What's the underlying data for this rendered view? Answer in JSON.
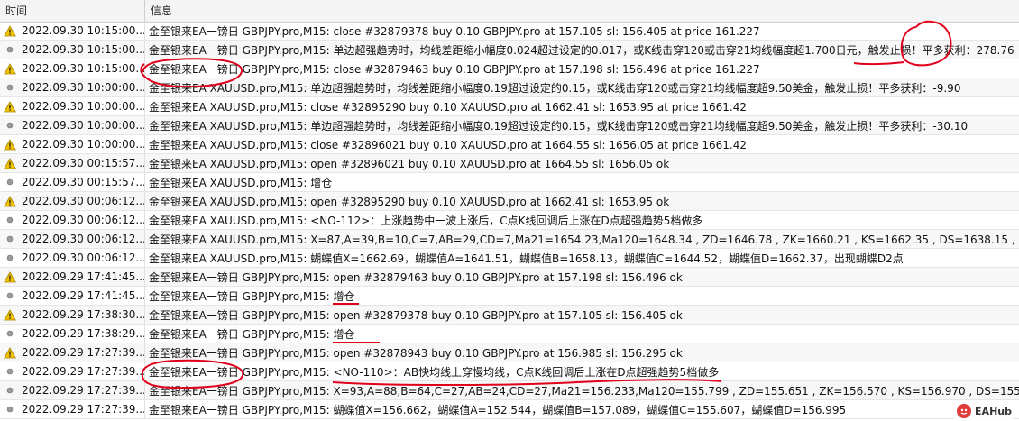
{
  "header": {
    "time": "时间",
    "message": "信息"
  },
  "rows": [
    {
      "icon": "warning",
      "time": "2022.09.30 10:15:00...",
      "msg": "金至银来EA一镑日 GBPJPY.pro,M15: close #32879378 buy 0.10 GBPJPY.pro at 157.105 sl: 156.405 at price 161.227"
    },
    {
      "icon": "info",
      "time": "2022.09.30 10:15:00...",
      "msg": "金至银来EA一镑日 GBPJPY.pro,M15: 单边超强趋势时，均线差距缩小幅度0.024超过设定的0.017，或K线击穿120或击穿21均线幅度超1.700日元，触发止损！平多获利：278.76"
    },
    {
      "icon": "warning",
      "time": "2022.09.30 10:15:00...",
      "msg": "金至银来EA一镑日 GBPJPY.pro,M15: close #32879463 buy 0.10 GBPJPY.pro at 157.198 sl: 156.496 at price 161.227"
    },
    {
      "icon": "info",
      "time": "2022.09.30 10:00:00...",
      "msg": "金至银来EA XAUUSD.pro,M15: 单边超强趋势时，均线差距缩小幅度0.19超过设定的0.15，或K线击穿120或击穿21均线幅度超9.50美金，触发止损！平多获利：-9.90"
    },
    {
      "icon": "warning",
      "time": "2022.09.30 10:00:00...",
      "msg": "金至银来EA XAUUSD.pro,M15: close #32895290 buy 0.10 XAUUSD.pro at 1662.41 sl: 1653.95 at price 1661.42"
    },
    {
      "icon": "info",
      "time": "2022.09.30 10:00:00...",
      "msg": "金至银来EA XAUUSD.pro,M15: 单边超强趋势时，均线差距缩小幅度0.19超过设定的0.15，或K线击穿120或击穿21均线幅度超9.50美金，触发止损！平多获利：-30.10"
    },
    {
      "icon": "warning",
      "time": "2022.09.30 10:00:00...",
      "msg": "金至银来EA XAUUSD.pro,M15: close #32896021 buy 0.10 XAUUSD.pro at 1664.55 sl: 1656.05 at price 1661.42"
    },
    {
      "icon": "warning",
      "time": "2022.09.30 00:15:57...",
      "msg": "金至银来EA XAUUSD.pro,M15: open #32896021 buy 0.10 XAUUSD.pro at 1664.55 sl: 1656.05 ok"
    },
    {
      "icon": "info",
      "time": "2022.09.30 00:15:57...",
      "msg": "金至银来EA XAUUSD.pro,M15: 增仓"
    },
    {
      "icon": "warning",
      "time": "2022.09.30 00:06:12...",
      "msg": "金至银来EA XAUUSD.pro,M15: open #32895290 buy 0.10 XAUUSD.pro at 1662.41 sl: 1653.95 ok"
    },
    {
      "icon": "info",
      "time": "2022.09.30 00:06:12...",
      "msg": "金至银来EA XAUUSD.pro,M15: <NO-112>：上涨趋势中一波上涨后，C点K线回调后上涨在D点超强趋势5档做多"
    },
    {
      "icon": "info",
      "time": "2022.09.30 00:06:12...",
      "msg": "金至银来EA XAUUSD.pro,M15: X=87,A=39,B=10,C=7,AB=29,CD=7,Ma21=1654.23,Ma120=1648.34 , ZD=1646.78 , ZK=1660.21 , KS=1662.35 , DS=1638.15 , GBH=1650"
    },
    {
      "icon": "info",
      "time": "2022.09.30 00:06:12...",
      "msg": "金至银来EA XAUUSD.pro,M15: 蝴蝶值X=1662.69，蝴蝶值A=1641.51，蝴蝶值B=1658.13，蝴蝶值C=1644.52，蝴蝶值D=1662.37，出现蝴蝶D2点"
    },
    {
      "icon": "warning",
      "time": "2022.09.29 17:41:45...",
      "msg": "金至银来EA一镑日 GBPJPY.pro,M15: open #32879463 buy 0.10 GBPJPY.pro at 157.198 sl: 156.496 ok"
    },
    {
      "icon": "info",
      "time": "2022.09.29 17:41:45...",
      "msg": "金至银来EA一镑日 GBPJPY.pro,M15: 增仓"
    },
    {
      "icon": "warning",
      "time": "2022.09.29 17:38:30...",
      "msg": "金至银来EA一镑日 GBPJPY.pro,M15: open #32879378 buy 0.10 GBPJPY.pro at 157.105 sl: 156.405 ok"
    },
    {
      "icon": "info",
      "time": "2022.09.29 17:38:29...",
      "msg": "金至银来EA一镑日 GBPJPY.pro,M15: 增仓"
    },
    {
      "icon": "warning",
      "time": "2022.09.29 17:27:39...",
      "msg": "金至银来EA一镑日 GBPJPY.pro,M15: open #32878943 buy 0.10 GBPJPY.pro at 156.985 sl: 156.295 ok"
    },
    {
      "icon": "info",
      "time": "2022.09.29 17:27:39...",
      "msg": "金至银来EA一镑日 GBPJPY.pro,M15: <NO-110>：AB快均线上穿慢均线，C点K线回调后上涨在D点超强趋势5档做多"
    },
    {
      "icon": "info",
      "time": "2022.09.29 17:27:39...",
      "msg": "金至银来EA一镑日 GBPJPY.pro,M15: X=93,A=88,B=64,C=27,AB=24,CD=27,Ma21=156.233,Ma120=155.799 , ZD=155.651 , ZK=156.570 , KS=156.970 , DS=155.296 , GB"
    },
    {
      "icon": "info",
      "time": "2022.09.29 17:27:39...",
      "msg": "金至银来EA一镑日 GBPJPY.pro,M15: 蝴蝶值X=156.662，蝴蝶值A=152.544，蝴蝶值B=157.089，蝴蝶值C=155.607，蝴蝶值D=156.995"
    }
  ],
  "watermark": {
    "text": "EAHub"
  },
  "colors": {
    "warning": "#f2c200",
    "info": "#9a9a9a",
    "annotation": "#e0001b"
  }
}
